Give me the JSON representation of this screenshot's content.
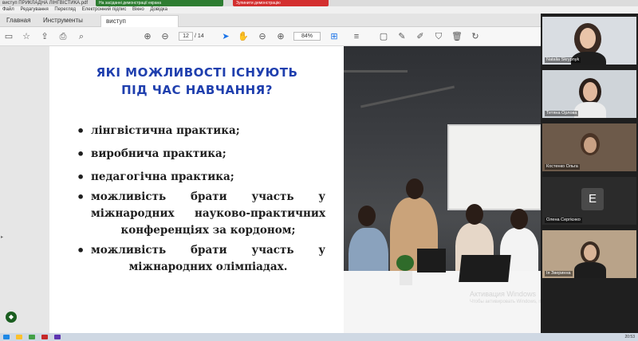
{
  "window": {
    "title": "виступ ПРИКЛАДНА ЛІНГВІСТИКА.pdf",
    "notif_green": "На засіданні демонстрації екрана",
    "notif_red": "Зупинити демонстрацію"
  },
  "menu": {
    "items": [
      "Файл",
      "Редагування",
      "Перегляд",
      "Електронний підпис",
      "Вікно",
      "Довідка"
    ]
  },
  "tabs": [
    {
      "label": "Главная"
    },
    {
      "label": "Инструменты"
    },
    {
      "label": "виступ ПРИКЛАДН..."
    }
  ],
  "toolbar": {
    "page_current": "12",
    "page_total": "/ 14",
    "zoom": "84%"
  },
  "slide": {
    "title_line1": "ЯКІ МОЖЛИВОСТІ ІСНУЮТЬ",
    "title_line2": "ПІД ЧАС НАВЧАННЯ?",
    "bullets": [
      "лінгвістична практика;",
      "виробнича практика;",
      "педагогічна практика;",
      "можливість брати участь у міжнародних науково-практичних",
      "конференціях за кордоном;",
      "можливість брати участь у",
      "міжнародних олімпіадах."
    ]
  },
  "watermark": {
    "line1": "Активация Windows",
    "line2": "Чтобы активировать Windows, перейдите в"
  },
  "participants": [
    {
      "name": "Natalia Skrypnyk"
    },
    {
      "name": "Тетяна Орлова"
    },
    {
      "name": "Костенко Ольга"
    },
    {
      "name": "Олена Сергієнко",
      "initial": "Е"
    },
    {
      "name": "Ія Зверинна"
    }
  ],
  "taskbar": {
    "clock": "20:53"
  }
}
